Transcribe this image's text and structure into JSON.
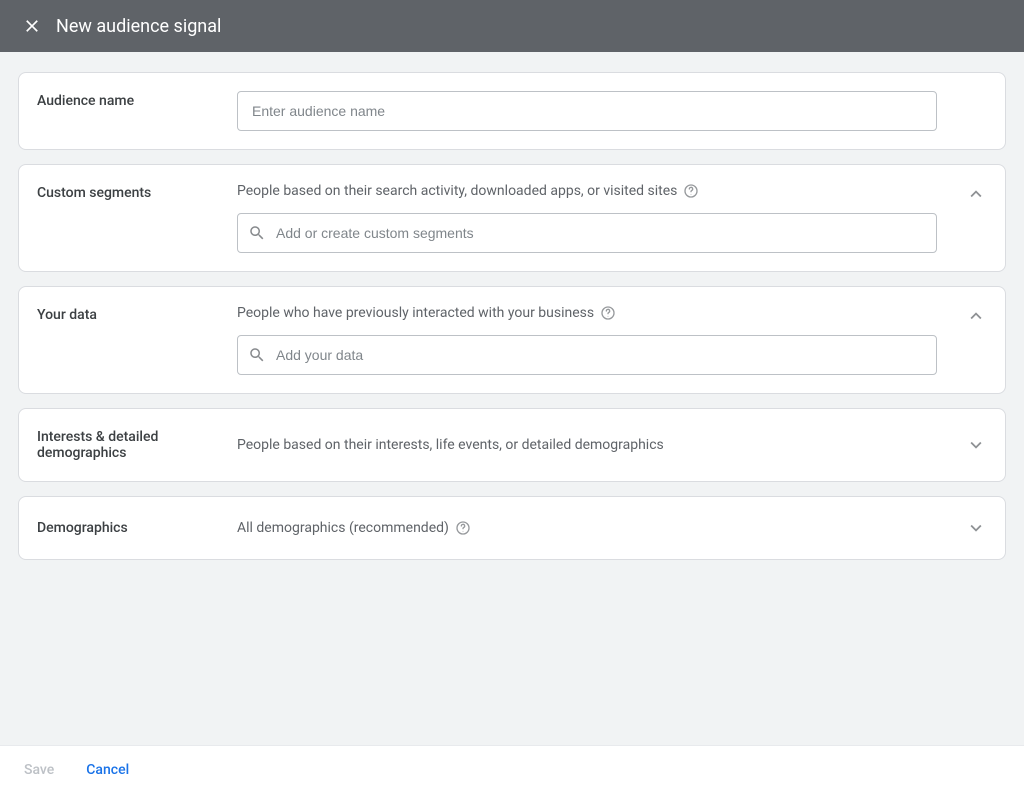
{
  "header": {
    "title": "New audience signal"
  },
  "audience": {
    "label": "Audience name",
    "placeholder": "Enter audience name",
    "value": ""
  },
  "customSegments": {
    "label": "Custom segments",
    "description": "People based on their search activity, downloaded apps, or visited sites",
    "searchPlaceholder": "Add or create custom segments"
  },
  "yourData": {
    "label": "Your data",
    "description": "People who have previously interacted with your business",
    "searchPlaceholder": "Add your data"
  },
  "interests": {
    "label": "Interests & detailed demographics",
    "description": "People based on their interests, life events, or detailed demographics"
  },
  "demographics": {
    "label": "Demographics",
    "description": "All demographics (recommended)"
  },
  "footer": {
    "save": "Save",
    "cancel": "Cancel"
  }
}
